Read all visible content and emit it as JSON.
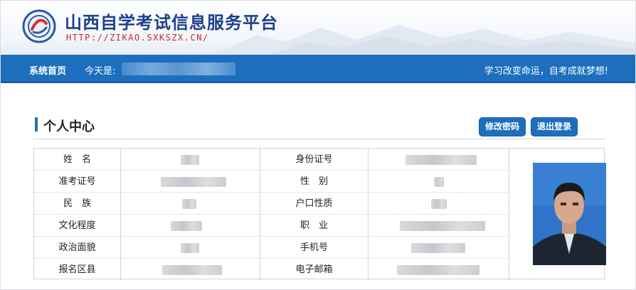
{
  "site": {
    "title": "山西自学考试信息服务平台",
    "url": "HTTP://ZIKAO.SXKSZX.CN/"
  },
  "nav": {
    "home": "系统首页",
    "today_label": "今天是:",
    "slogan": "学习改变命运，自考成就梦想!"
  },
  "section": {
    "title": "个人中心"
  },
  "buttons": {
    "change_password": "修改密码",
    "logout": "退出登录"
  },
  "profile": {
    "rows": [
      {
        "label_left": "姓　名",
        "label_right": "身份证号"
      },
      {
        "label_left": "准考证号",
        "label_right": "性　别"
      },
      {
        "label_left": "民　族",
        "label_right": "户口性质"
      },
      {
        "label_left": "文化程度",
        "label_right": "职　业"
      },
      {
        "label_left": "政治面貌",
        "label_right": "手机号"
      },
      {
        "label_left": "报名区县",
        "label_right": "电子邮箱"
      }
    ]
  },
  "colors": {
    "brand_blue": "#1d6fbd",
    "title_blue": "#1d3f8a",
    "url_red": "#c62a2a"
  },
  "icons": {
    "logo": "exam-logo-icon",
    "photo": "id-photo-image"
  }
}
